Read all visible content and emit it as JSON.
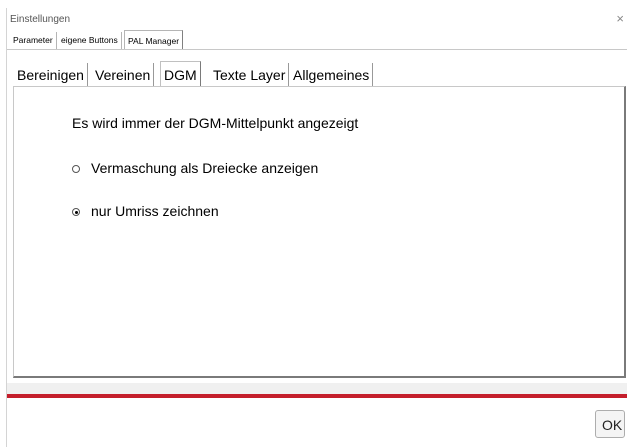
{
  "window": {
    "title": "Einstellungen",
    "close_glyph": "×"
  },
  "outer_tabs": [
    {
      "label": "Parameter",
      "active": false
    },
    {
      "label": "eigene Buttons",
      "active": false
    },
    {
      "label": "PAL Manager",
      "active": true
    }
  ],
  "inner_tabs": [
    {
      "label": "Bereinigen",
      "active": false
    },
    {
      "label": "Vereinen",
      "active": false
    },
    {
      "label": "DGM",
      "active": true
    },
    {
      "label": "Texte Layer",
      "active": false
    },
    {
      "label": "Allgemeines",
      "active": false
    }
  ],
  "dgm": {
    "info_text": "Es wird immer der DGM-Mittelpunkt angezeigt",
    "options": [
      {
        "label": "Vermaschung als Dreiecke anzeigen",
        "checked": false
      },
      {
        "label": "nur Umriss zeichnen",
        "checked": true
      }
    ]
  },
  "footer": {
    "ok_label": "OK"
  },
  "colors": {
    "accent_line": "#c41e2b"
  }
}
